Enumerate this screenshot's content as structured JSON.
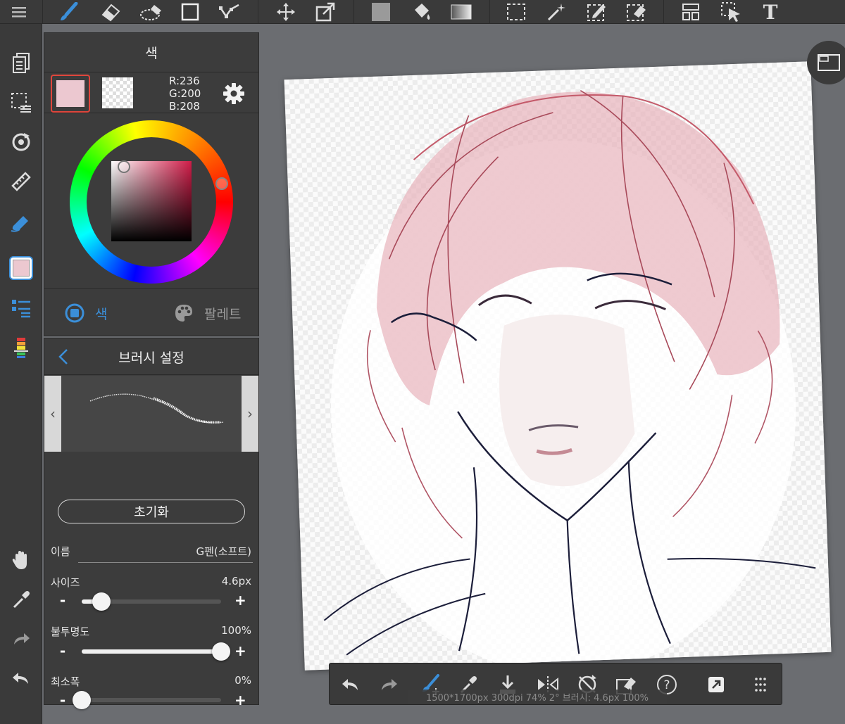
{
  "colors": {
    "accent": "#3b8fd9",
    "foreground_swatch": "#ecc8d0",
    "selection_border": "#e0463c",
    "panel_bg": "#3c3c3c",
    "toolbar_bg": "#3a3a3a",
    "canvas_bg": "#6b6d71"
  },
  "top_toolbar": {
    "icons": [
      "menu-icon",
      "brush-icon",
      "eraser-icon",
      "blur-icon",
      "rectangle-icon",
      "polyline-icon",
      "move-icon",
      "transform-icon",
      "fill-rect-icon",
      "bucket-icon",
      "gradient-icon",
      "select-rect-icon",
      "magic-wand-icon",
      "select-pen-icon",
      "select-eraser-icon",
      "panel-icon",
      "select-move-icon",
      "text-icon"
    ],
    "text_tool": "T"
  },
  "color_panel": {
    "title": "색",
    "rgb": {
      "r": "R:236",
      "g": "G:200",
      "b": "B:208"
    },
    "tab_color": "색",
    "tab_palette": "팔레트"
  },
  "brush_panel": {
    "title": "브러시 설정",
    "reset_label": "초기화",
    "name_label": "이름",
    "name_value": "G펜(소프트)",
    "size_label": "사이즈",
    "size_value": "4.6px",
    "size_fraction": 0.14,
    "opacity_label": "불투명도",
    "opacity_value": "100%",
    "opacity_fraction": 1.0,
    "minwidth_label": "최소폭",
    "minwidth_value": "0%",
    "minwidth_fraction": 0.0,
    "minus": "-",
    "plus": "+"
  },
  "status": "1500*1700px 300dpi 74% 2° 브러시: 4.6px 100%"
}
